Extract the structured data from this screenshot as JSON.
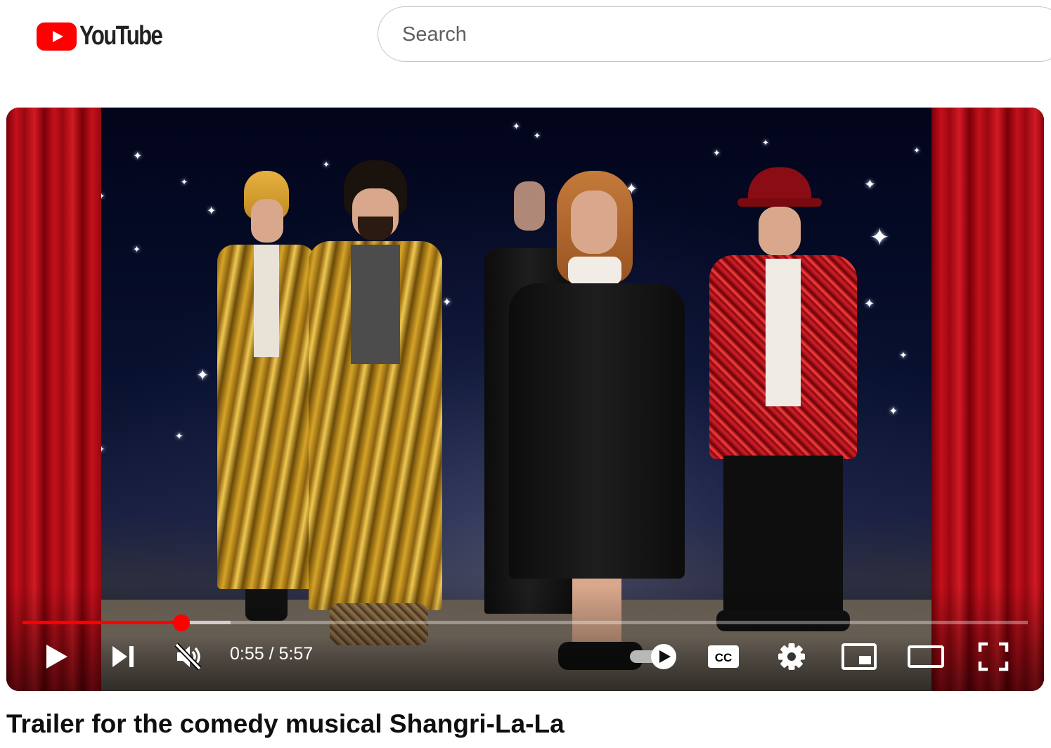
{
  "header": {
    "logo_text": "YouTube",
    "search_placeholder": "Search"
  },
  "player": {
    "time_current": "0:55",
    "time_separator": "/",
    "time_total": "5:57",
    "time_display": "0:55 / 5:57",
    "progress_played_fraction": 0.158,
    "progress_buffered_fraction": 0.207,
    "autoplay_on": true,
    "muted": true,
    "cc_label": "CC",
    "colors": {
      "progress": "#ff0000",
      "curtain": "#c4101c"
    },
    "icons": [
      "play-icon",
      "next-icon",
      "volume-muted-icon",
      "autoplay-toggle-icon",
      "cc-icon",
      "settings-gear-icon",
      "miniplayer-icon",
      "theater-mode-icon",
      "fullscreen-icon"
    ]
  },
  "video": {
    "title": "Trailer for the comedy musical Shangri-La-La"
  }
}
